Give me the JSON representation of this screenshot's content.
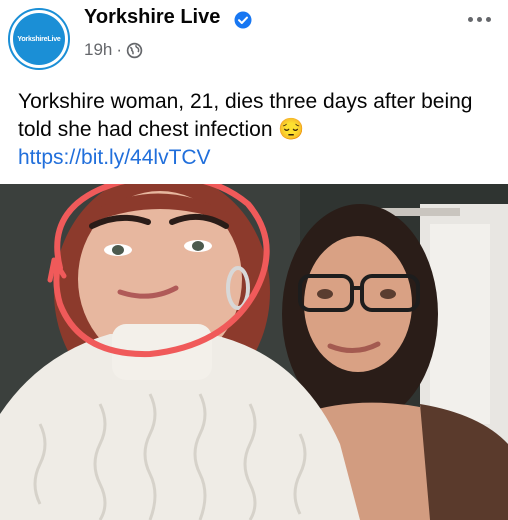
{
  "page": {
    "name": "Yorkshire Live",
    "avatar_text": "YorkshireLive",
    "time": "19h",
    "separator": "·"
  },
  "post": {
    "text": "Yorkshire woman, 21, dies three days after being told she had chest infection 😔",
    "link": "https://bit.ly/44lvTCV"
  },
  "colors": {
    "brand": "#1b8fd6",
    "link": "#216fdb",
    "meta": "#65676b",
    "annotation": "#f05a5a"
  },
  "icons": {
    "verified": "verified-badge-icon",
    "audience": "globe-icon",
    "more": "more-options-icon"
  }
}
